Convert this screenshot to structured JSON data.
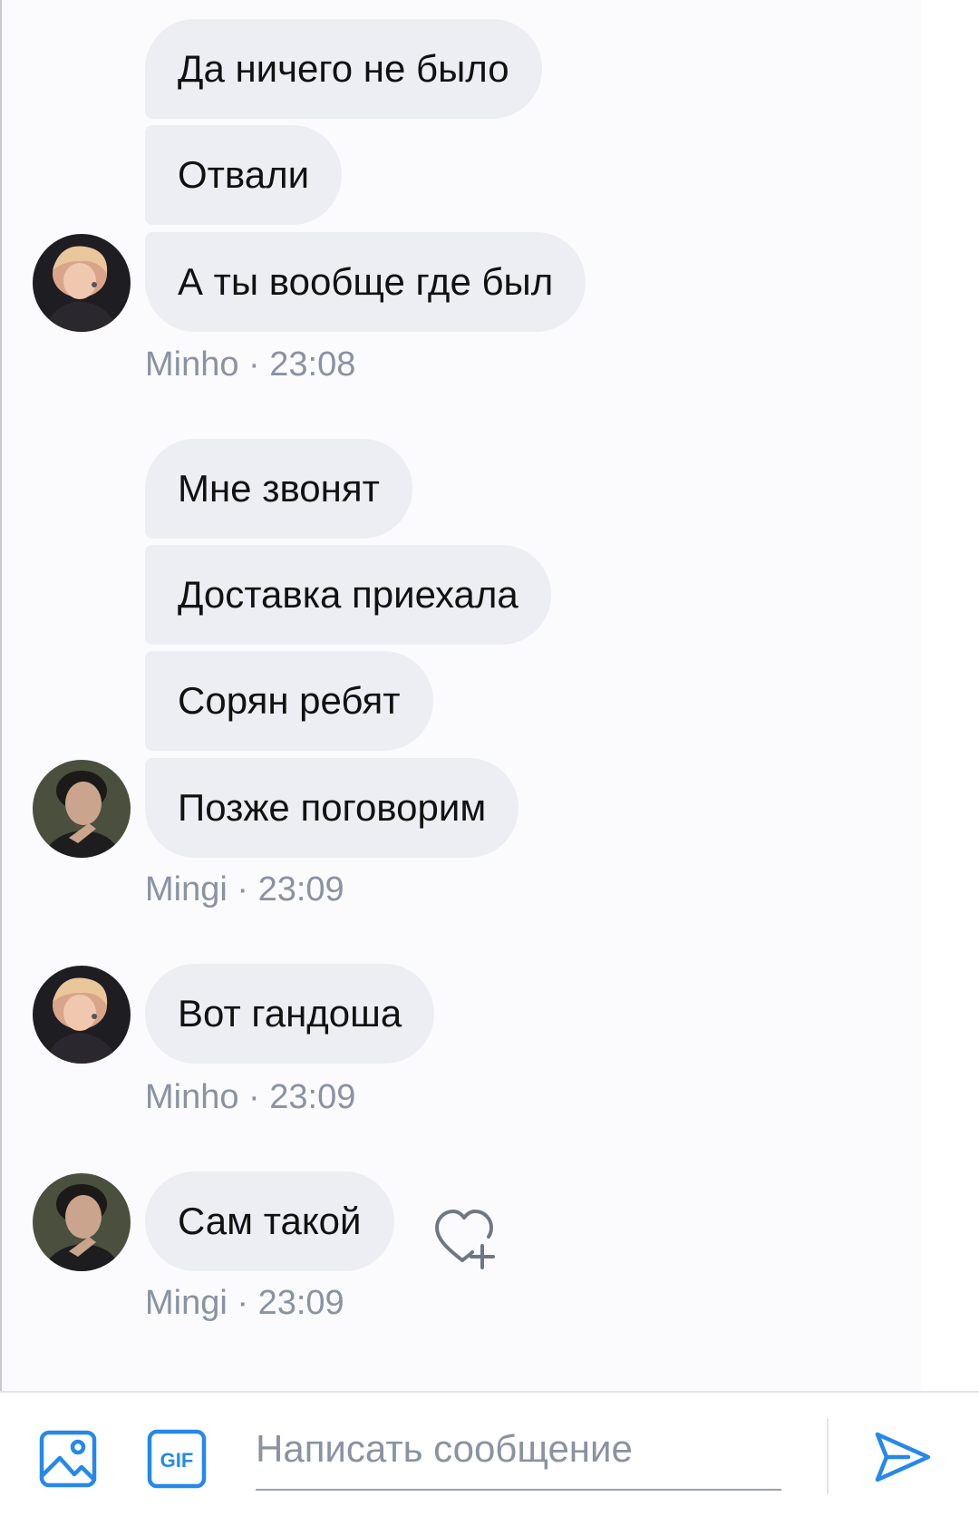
{
  "colors": {
    "bubble_bg": "#eceef3",
    "meta_text": "#8a92a3",
    "accent": "#2688eb",
    "background": "#fbfbfe"
  },
  "messages": [
    {
      "author": "Minho",
      "time": "23:08",
      "meta": "Minho · 23:08",
      "avatar": "minho-avatar",
      "bubbles": [
        "Да ничего не было",
        "Отвали",
        "А ты вообще где был"
      ]
    },
    {
      "author": "Mingi",
      "time": "23:09",
      "meta": "Mingi · 23:09",
      "avatar": "mingi-avatar",
      "bubbles": [
        "Мне звонят",
        "Доставка приехала",
        "Сорян ребят",
        "Позже поговорим"
      ]
    },
    {
      "author": "Minho",
      "time": "23:09",
      "meta": "Minho · 23:09",
      "avatar": "minho-avatar",
      "bubbles": [
        "Вот гандоша"
      ]
    },
    {
      "author": "Mingi",
      "time": "23:09",
      "meta": "Mingi · 23:09",
      "avatar": "mingi-avatar",
      "bubbles": [
        "Сам такой"
      ],
      "reaction_icon": "heart-plus-icon"
    }
  ],
  "composer": {
    "placeholder": "Написать сообщение",
    "value": "",
    "attach_image_icon": "image-icon",
    "gif_label": "GIF",
    "send_icon": "send-icon"
  }
}
